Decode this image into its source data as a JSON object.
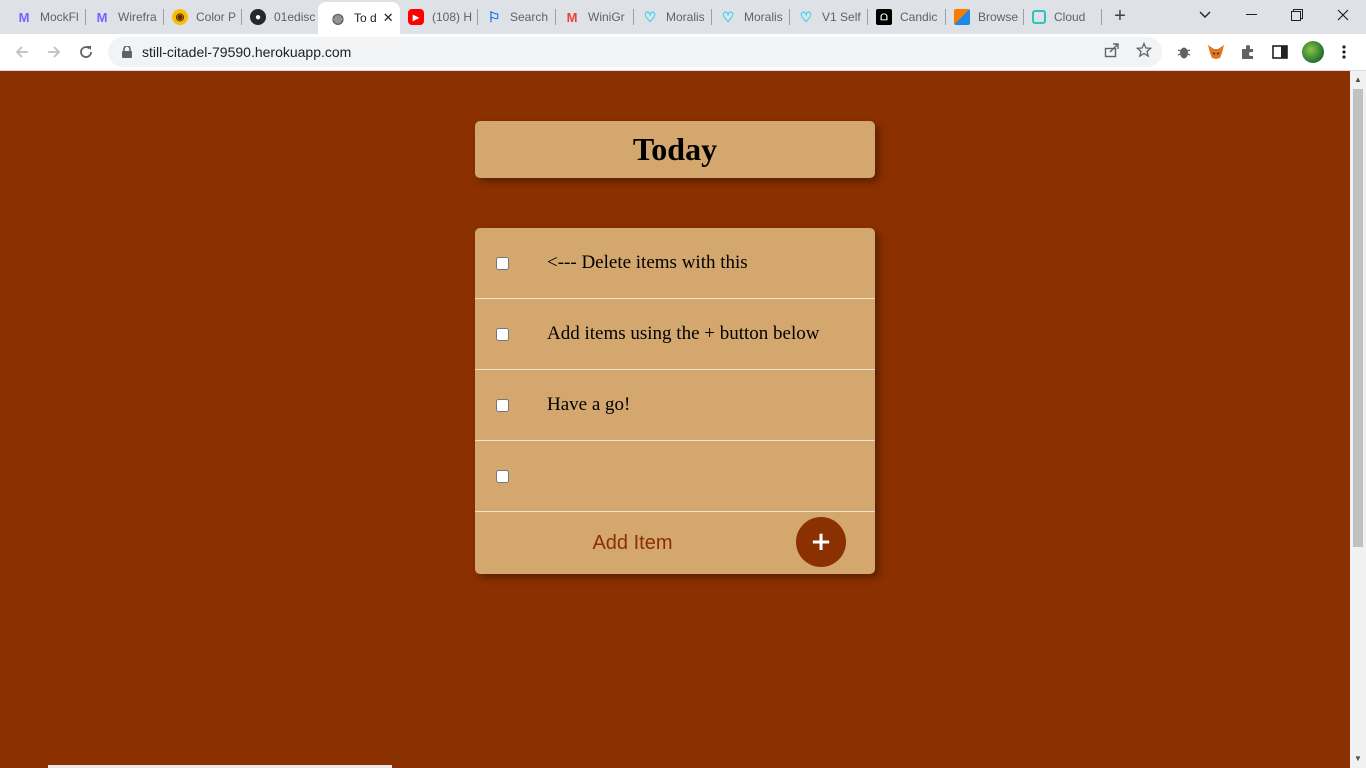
{
  "browser": {
    "tabs": [
      {
        "title": "MockFl",
        "icon": "mockflow-icon",
        "color": "#7b61ff"
      },
      {
        "title": "Wirefra",
        "icon": "mockflow-icon",
        "color": "#7b61ff"
      },
      {
        "title": "Color P",
        "icon": "color-picker-icon",
        "color": "#fbbc04"
      },
      {
        "title": "01edisc",
        "icon": "github-icon",
        "color": "#24292e"
      },
      {
        "title": "To d",
        "icon": "globe-icon",
        "color": "#5f6368",
        "active": true
      },
      {
        "title": "(108) H",
        "icon": "youtube-icon",
        "color": "#ff0000"
      },
      {
        "title": "Search",
        "icon": "flag-icon",
        "color": "#1a73e8"
      },
      {
        "title": "WiniGr",
        "icon": "gmail-icon",
        "color": "#ea4335"
      },
      {
        "title": "Moralis",
        "icon": "moralis-icon",
        "color": "#21d4f6"
      },
      {
        "title": "Moralis",
        "icon": "moralis-icon",
        "color": "#21d4f6"
      },
      {
        "title": "V1 Self",
        "icon": "moralis-icon",
        "color": "#21d4f6"
      },
      {
        "title": "Candic",
        "icon": "candid-icon",
        "color": "#000000"
      },
      {
        "title": "Browse",
        "icon": "browse-icon",
        "color": "#f57c00"
      },
      {
        "title": "Cloud",
        "icon": "cloud-icon",
        "color": "#2ec4b6"
      }
    ],
    "new_tab_glyph": "+",
    "url": "still-citadel-79590.herokuapp.com"
  },
  "todo": {
    "heading": "Today",
    "items": [
      {
        "text": "<--- Delete items with this"
      },
      {
        "text": "Add items using the + button below"
      },
      {
        "text": "Have a go!"
      },
      {
        "text": ""
      }
    ],
    "add_placeholder": "Add Item",
    "add_button_label": "+"
  },
  "colors": {
    "page_background": "#8b3000",
    "card_background": "#d3a76d",
    "accent": "#8b3000"
  }
}
